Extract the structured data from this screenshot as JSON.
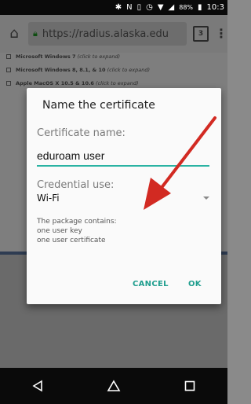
{
  "status_bar": {
    "bluetooth_icon": "bluetooth-icon",
    "nfc_icon": "nfc-icon",
    "vibrate_icon": "vibrate-icon",
    "alarm_icon": "alarm-icon",
    "wifi_icon": "wifi-icon",
    "signal_icon": "signal-icon",
    "battery_percent": "88%",
    "time": "10:3"
  },
  "browser": {
    "url": "https://radius.alaska.edu",
    "tab_count": "3"
  },
  "page": {
    "items": [
      {
        "name": "Microsoft Windows 7",
        "hint": "(click to expand)"
      },
      {
        "name": "Microsoft Windows 8, 8.1, & 10",
        "hint": "(click to expand)"
      },
      {
        "name": "Apple MacOS X 10.5 & 10.6",
        "hint": "(click to expand)"
      }
    ]
  },
  "dialog": {
    "title": "Name the certificate",
    "certificate_name_label": "Certificate name:",
    "certificate_name_value": "eduroam user",
    "credential_use_label": "Credential use:",
    "credential_use_value": "Wi-Fi",
    "package_heading": "The package contains:",
    "package_items": [
      "one user key",
      "one user certificate"
    ],
    "cancel_label": "CANCEL",
    "ok_label": "OK"
  },
  "colors": {
    "accent": "#2bb3a3",
    "button_text": "#1f9e8e",
    "arrow": "#d22a22"
  }
}
